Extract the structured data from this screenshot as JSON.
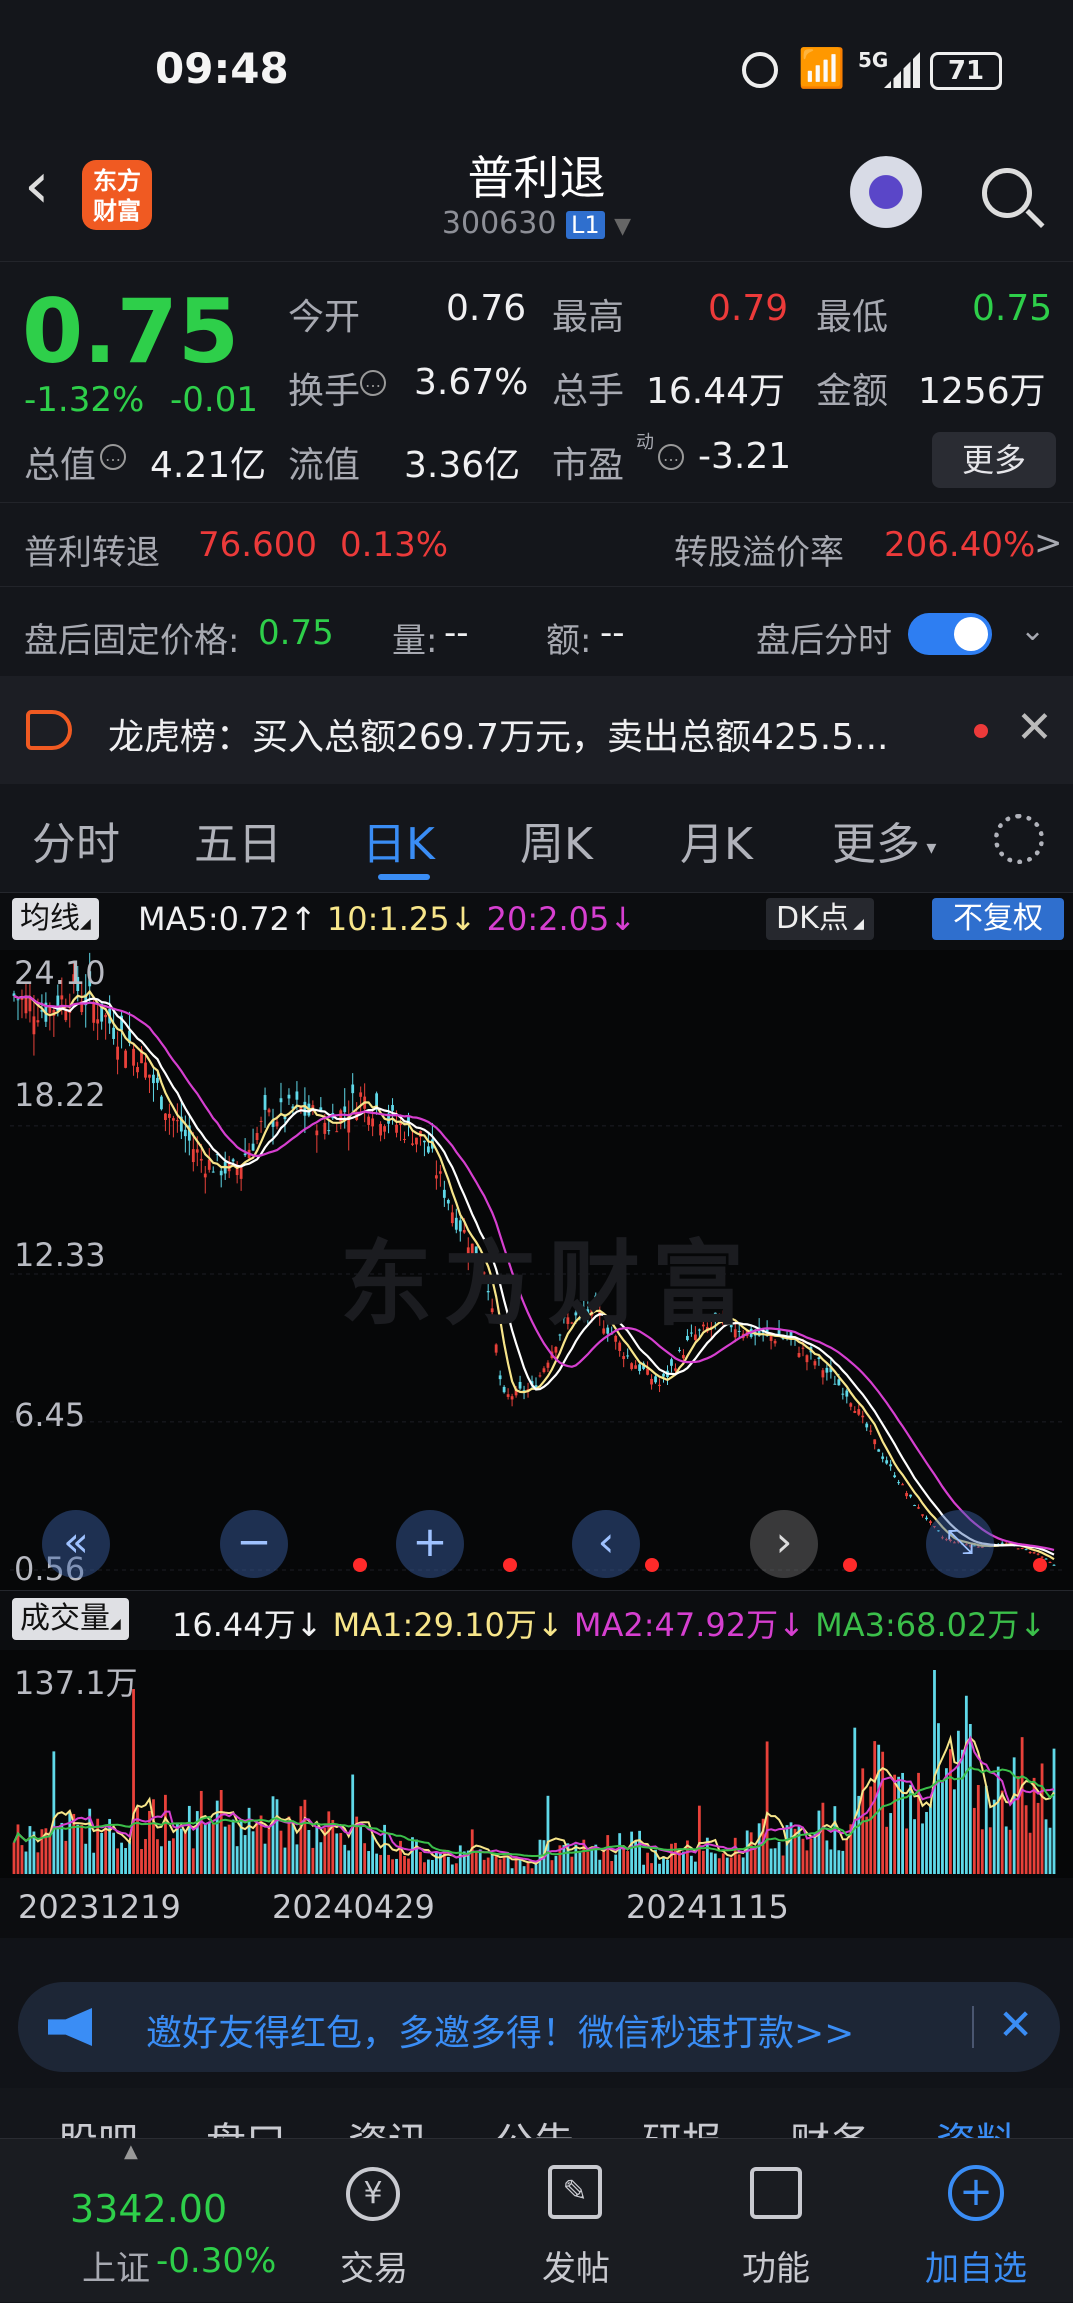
{
  "status_bar": {
    "time": "09:48",
    "battery": "71",
    "network": "5G"
  },
  "header": {
    "title": "普利退",
    "code": "300630",
    "level_badge": "L1",
    "logo_text_1": "东方",
    "logo_text_2": "财富"
  },
  "quote": {
    "price": "0.75",
    "change_pct": "-1.32%",
    "change": "-0.01",
    "open_label": "今开",
    "open": "0.76",
    "high_label": "最高",
    "high": "0.79",
    "low_label": "最低",
    "low": "0.75",
    "turnover_label": "换手",
    "turnover": "3.67%",
    "volume_label": "总手",
    "volume": "16.44万",
    "amount_label": "金额",
    "amount": "1256万",
    "mktcap_label": "总值",
    "mktcap": "4.21亿",
    "float_label": "流值",
    "float": "3.36亿",
    "pe_label": "市盈",
    "pe_sup": "动",
    "pe": "-3.21",
    "more_button": "更多"
  },
  "convert": {
    "label": "普利转退",
    "price": "76.600",
    "pct": "0.13%",
    "premium_label": "转股溢价率",
    "premium": "206.40%",
    "arrow": ">"
  },
  "after_hours": {
    "label": "盘后固定价格:",
    "price": "0.75",
    "vol_label": "量:",
    "vol": "--",
    "amt_label": "额:",
    "amt": "--",
    "toggle_label": "盘后分时",
    "toggle_on": true
  },
  "notice": {
    "text": "龙虎榜：买入总额269.7万元，卖出总额425.5..."
  },
  "chart_tabs": [
    "分时",
    "五日",
    "日K",
    "周K",
    "月K",
    "更多"
  ],
  "chart_tabs_active": 2,
  "kline": {
    "ma_button": "均线",
    "ma5": "MA5:0.72",
    "ma10": "10:1.25",
    "ma20": "20:2.05",
    "dk_button": "DK点",
    "adjust_button": "不复权",
    "watermark": "东方财富"
  },
  "volume_panel": {
    "button": "成交量",
    "vol": "16.44万",
    "ma1": "MA1:29.10万",
    "ma2": "MA2:47.92万",
    "ma3": "MA3:68.02万",
    "ytick": "137.1万"
  },
  "chart_data": {
    "type": "candlestick",
    "y_ticks": [
      "24.10",
      "18.22",
      "12.33",
      "6.45",
      "0.56"
    ],
    "ylim": [
      0.56,
      24.1
    ],
    "x_ticks": [
      "20231219",
      "20240429",
      "20241115"
    ],
    "close_path": [
      [
        0,
        23.4
      ],
      [
        4,
        22.8
      ],
      [
        8,
        23.7
      ],
      [
        12,
        22.4
      ],
      [
        16,
        21.0
      ],
      [
        20,
        18.6
      ],
      [
        24,
        16.8
      ],
      [
        28,
        16.4
      ],
      [
        32,
        18.5
      ],
      [
        36,
        18.9
      ],
      [
        40,
        18.3
      ],
      [
        44,
        19.4
      ],
      [
        48,
        18.4
      ],
      [
        52,
        17.7
      ],
      [
        56,
        14.6
      ],
      [
        60,
        12.4
      ],
      [
        62,
        7.4
      ],
      [
        66,
        7.8
      ],
      [
        70,
        10.5
      ],
      [
        74,
        10.8
      ],
      [
        78,
        9.0
      ],
      [
        82,
        7.9
      ],
      [
        86,
        9.8
      ],
      [
        90,
        10.5
      ],
      [
        94,
        9.9
      ],
      [
        98,
        9.8
      ],
      [
        102,
        8.8
      ],
      [
        106,
        7.5
      ],
      [
        110,
        5.2
      ],
      [
        114,
        3.3
      ],
      [
        118,
        1.8
      ],
      [
        122,
        1.5
      ],
      [
        126,
        1.6
      ],
      [
        130,
        1.2
      ],
      [
        132,
        0.75
      ]
    ],
    "ma_series": [
      {
        "name": "MA5",
        "color": "#f7e58a"
      },
      {
        "name": "MA10",
        "color": "#ffffff"
      },
      {
        "name": "MA20",
        "color": "#d63fd0"
      }
    ]
  },
  "chart_controls": [
    "«",
    "−",
    "+",
    "‹",
    "›"
  ],
  "promo": {
    "text": "邀好友得红包，多邀多得！微信秒速打款>>"
  },
  "sub_tabs": [
    "股吧",
    "盘口",
    "资讯",
    "公告",
    "研报",
    "财务",
    "资料"
  ],
  "bottom_nav": {
    "index_value": "3342.00",
    "index_name": "上证",
    "index_change": "-0.30%",
    "items": [
      "交易",
      "发帖",
      "功能",
      "加自选"
    ]
  }
}
